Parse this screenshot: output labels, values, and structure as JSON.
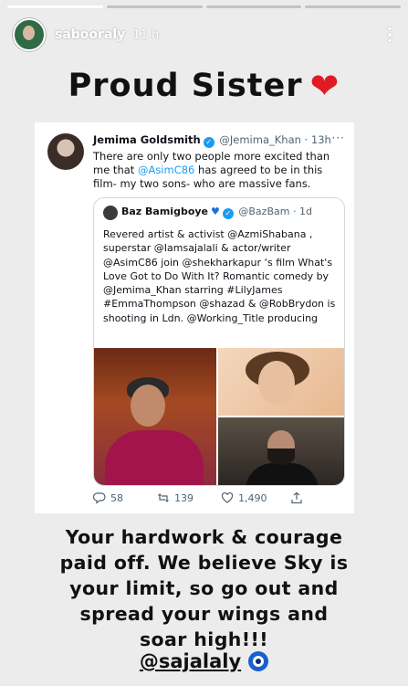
{
  "story": {
    "username": "sabooraly",
    "time_ago": "11 h",
    "progress_segments_total": 4,
    "progress_segments_done": 1
  },
  "headline": {
    "text": "Proud Sister",
    "emoji": "❤"
  },
  "tweet": {
    "author_name": "Jemima Goldsmith",
    "author_handle": "@Jemima_Khan",
    "time": "13h",
    "more": "···",
    "text_before": "There are only two people more excited than me that ",
    "text_mention": "@AsimC86",
    "text_after": " has agreed to be in this film- my two sons-  who are massive fans.",
    "quote": {
      "author_name": "Baz Bamigboye",
      "author_handle": "@BazBam",
      "time": "1d",
      "text": "Revered artist & activist @AzmiShabana , superstar @Iamsajalali & actor/writer @AsimC86 join @shekharkapur ‘s film What's Love Got to Do With It? Romantic comedy by @Jemima_Khan starring #LilyJames #EmmaThompson @shazad & @RobBrydon is shooting in Ldn. @Working_Title producing"
    },
    "stats": {
      "replies": "58",
      "retweets": "139",
      "likes": "1,490"
    }
  },
  "caption": {
    "lines": [
      "Your hardwork & courage",
      "paid off. We believe Sky is",
      "your limit, so go out and",
      "spread your wings and",
      "soar high!!!"
    ],
    "tag": "@sajalaly"
  },
  "colors": {
    "accent": "#1d9bf0",
    "heart": "#e21b22",
    "background": "#ececec"
  },
  "icons": [
    "more-vertical-icon",
    "verified-badge-icon",
    "blue-heart-icon",
    "reply-icon",
    "retweet-icon",
    "like-icon",
    "share-icon",
    "nazar-eye-icon"
  ]
}
